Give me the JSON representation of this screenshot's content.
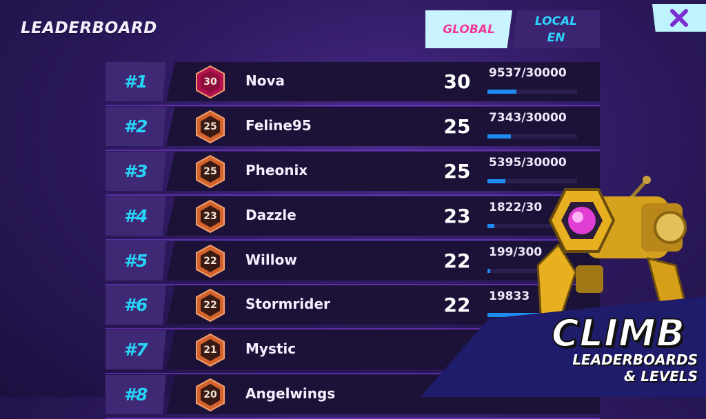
{
  "header": {
    "title": "LEADERBOARD"
  },
  "tabs": {
    "global": "GLOBAL",
    "local": "LOCAL\nEN"
  },
  "close": {
    "icon": "close-icon"
  },
  "rows": [
    {
      "rank": "#1",
      "badge": "30",
      "name": "Nova",
      "level": "30",
      "xp": "9537/30000",
      "progress": 0.32,
      "badge_color": "#b3124e"
    },
    {
      "rank": "#2",
      "badge": "25",
      "name": "Feline95",
      "level": "25",
      "xp": "7343/30000",
      "progress": 0.26,
      "badge_color": "#d4632b"
    },
    {
      "rank": "#3",
      "badge": "25",
      "name": "Pheonix",
      "level": "25",
      "xp": "5395/30000",
      "progress": 0.2,
      "badge_color": "#d4632b"
    },
    {
      "rank": "#4",
      "badge": "23",
      "name": "Dazzle",
      "level": "23",
      "xp": "1822/30",
      "progress": 0.08,
      "badge_color": "#d4632b"
    },
    {
      "rank": "#5",
      "badge": "22",
      "name": "Willow",
      "level": "22",
      "xp": "199/300",
      "progress": 0.03,
      "badge_color": "#d4632b"
    },
    {
      "rank": "#6",
      "badge": "22",
      "name": "Stormrider",
      "level": "22",
      "xp": "19833",
      "progress": 0.95,
      "badge_color": "#d4632b"
    },
    {
      "rank": "#7",
      "badge": "21",
      "name": "Mystic",
      "level": "",
      "xp": "",
      "progress": null,
      "badge_color": "#d4632b"
    },
    {
      "rank": "#8",
      "badge": "20",
      "name": "Angelwings",
      "level": "",
      "xp": "",
      "progress": null,
      "badge_color": "#d4632b"
    }
  ],
  "promo": {
    "title": "CLIMB",
    "subtitle": "LEADERBOARDS\n& LEVELS"
  },
  "colors": {
    "accent_cyan": "#27d2f7",
    "accent_pink": "#f2399a",
    "xp_bar": "#1e8cf0"
  }
}
